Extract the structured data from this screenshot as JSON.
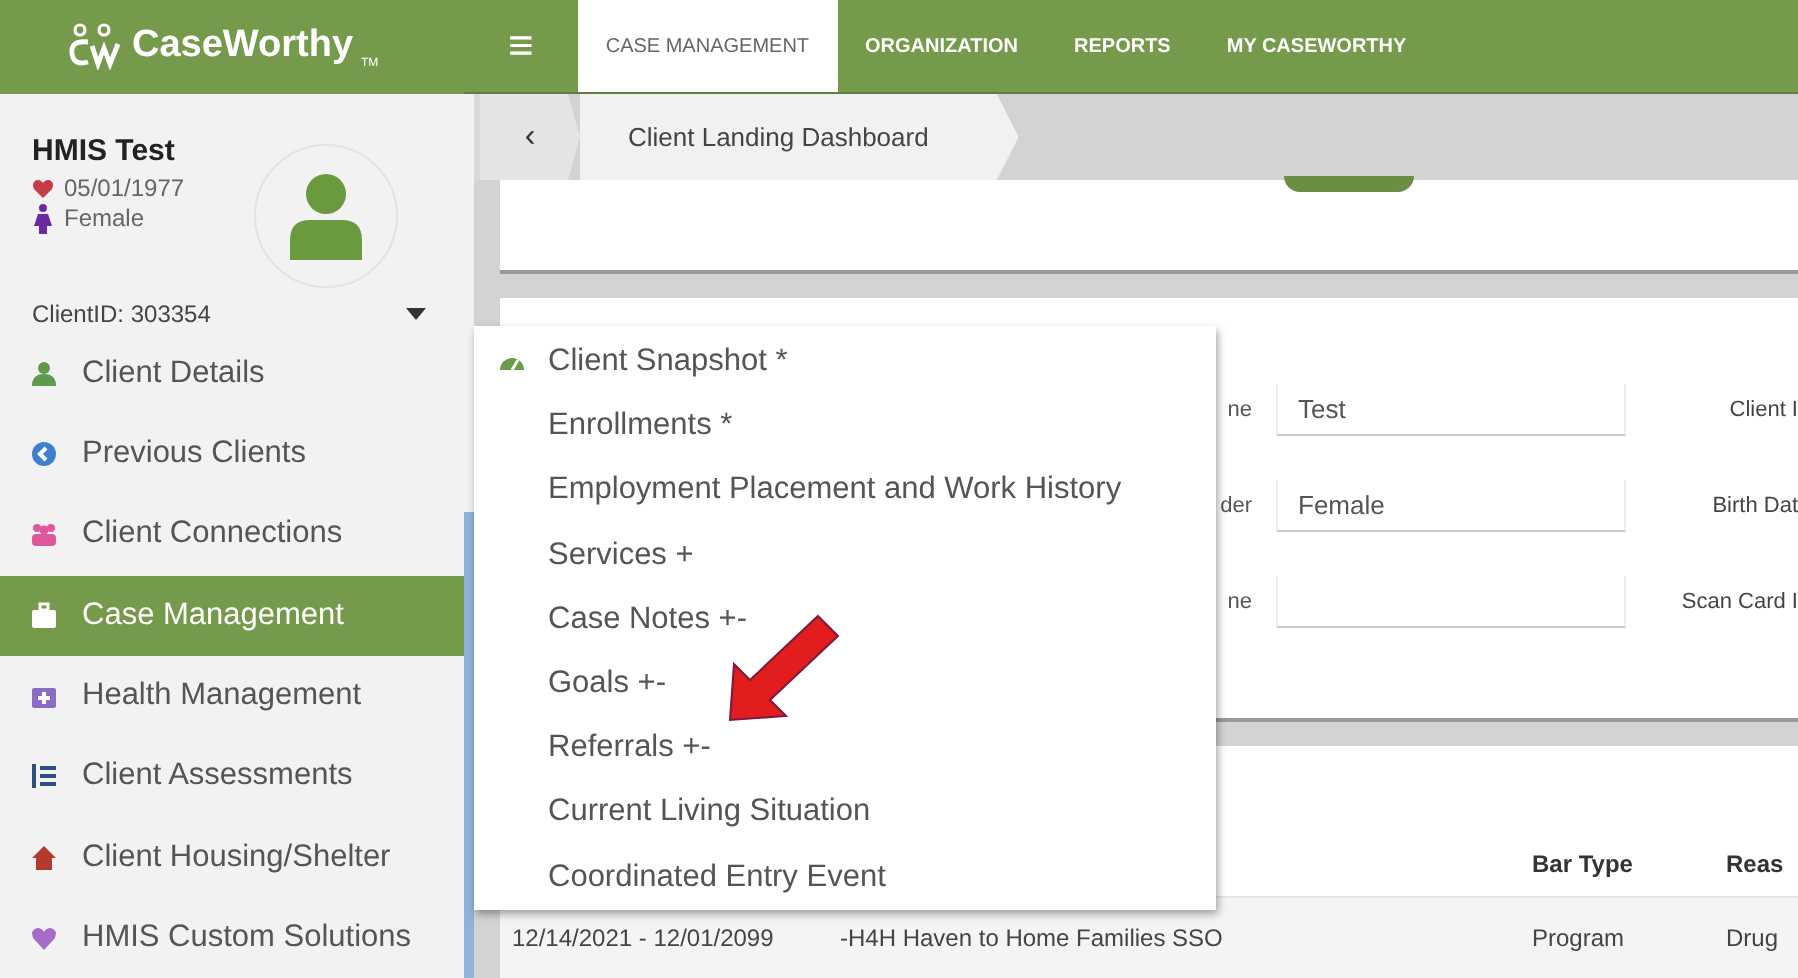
{
  "logo": {
    "name": "CaseWorthy",
    "trademark": "TM"
  },
  "client": {
    "name": "HMIS Test",
    "birth_date": "05/01/1977",
    "gender": "Female",
    "client_id": "ClientID: 303354"
  },
  "sidebar": {
    "items": [
      {
        "label": "Client Details",
        "kind": "person",
        "selected": false
      },
      {
        "label": "Previous Clients",
        "kind": "back",
        "selected": false
      },
      {
        "label": "Client Connections",
        "kind": "group",
        "selected": false
      },
      {
        "label": "Case Management",
        "kind": "briefcase",
        "selected": true
      },
      {
        "label": "Health Management",
        "kind": "medkit",
        "selected": false
      },
      {
        "label": "Client Assessments",
        "kind": "list",
        "selected": false
      },
      {
        "label": "Client Housing/Shelter",
        "kind": "house",
        "selected": false
      },
      {
        "label": "HMIS Custom Solutions",
        "kind": "heart",
        "selected": false
      }
    ]
  },
  "top_nav": {
    "menu_icon": "≡",
    "tabs": [
      {
        "label": "CASE MANAGEMENT",
        "selected": true
      },
      {
        "label": "ORGANIZATION",
        "selected": false
      },
      {
        "label": "REPORTS",
        "selected": false
      },
      {
        "label": "MY CASEWORTHY",
        "selected": false
      }
    ]
  },
  "breadcrumb": {
    "back": "‹",
    "items": [
      "Client Landing Dashboard"
    ]
  },
  "form": {
    "rows": [
      {
        "label": "ne",
        "value": "Test",
        "right_label": "Client I"
      },
      {
        "label": "der",
        "value": "Female",
        "right_label": "Birth Dat"
      },
      {
        "label": "ne",
        "right_label": "Scan Card I"
      }
    ]
  },
  "table": {
    "headers": [
      "Bar Type",
      "Reas"
    ],
    "rows": [
      {
        "cells": [
          "12/14/2021 - 12/01/2099",
          "-H4H Haven to Home Families SSO",
          "Program",
          "Drug"
        ]
      }
    ]
  },
  "dropdown_menu": {
    "items": [
      {
        "label": "Client Snapshot *",
        "kind": "gauge"
      },
      {
        "label": "Enrollments *"
      },
      {
        "label": "Employment Placement and Work History"
      },
      {
        "label": "Services +"
      },
      {
        "label": "Case Notes +-"
      },
      {
        "label": "Goals +-"
      },
      {
        "label": "Referrals +-"
      },
      {
        "label": "Current Living Situation"
      },
      {
        "label": "Coordinated Entry Event"
      }
    ]
  }
}
